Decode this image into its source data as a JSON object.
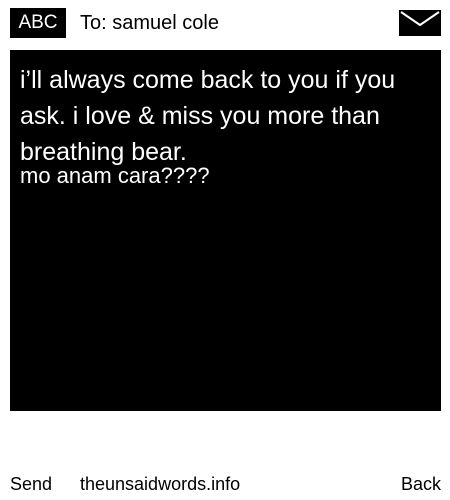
{
  "header": {
    "input_mode": "ABC",
    "to_line": "To: samuel cole",
    "mail_icon": "envelope-icon"
  },
  "message": {
    "body": "i’ll always come back to you if you ask. i love & miss you more than breathing bear.",
    "signoff": "mo anam cara????"
  },
  "footer": {
    "send_label": "Send",
    "site": "theunsaidwords.info",
    "back_label": "Back"
  }
}
